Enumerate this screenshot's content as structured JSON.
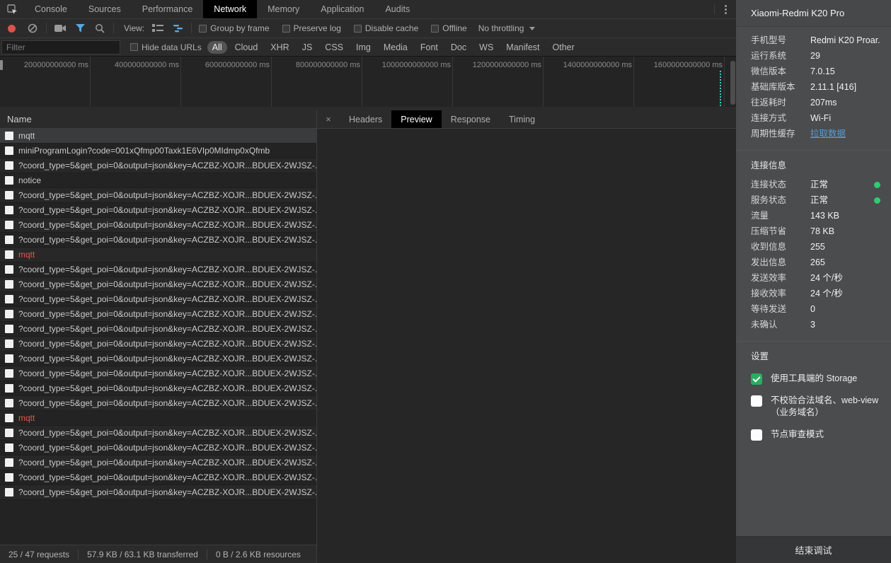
{
  "main_tabs": {
    "items": [
      {
        "label": "Console",
        "state": ""
      },
      {
        "label": "Sources",
        "state": ""
      },
      {
        "label": "Performance",
        "state": ""
      },
      {
        "label": "Network",
        "state": "active"
      },
      {
        "label": "Memory",
        "state": ""
      },
      {
        "label": "Application",
        "state": ""
      },
      {
        "label": "Audits",
        "state": ""
      }
    ]
  },
  "toolbar": {
    "view_label": "View:",
    "checkboxes": [
      {
        "label": "Group by frame",
        "state": "unchecked"
      },
      {
        "label": "Preserve log",
        "state": "unchecked"
      },
      {
        "label": "Disable cache",
        "state": "unchecked"
      },
      {
        "label": "Offline",
        "state": "unchecked"
      }
    ],
    "throttling_value": "No throttling"
  },
  "filter_bar": {
    "filter_placeholder": "Filter",
    "hide_data_urls_label": "Hide data URLs",
    "chips": [
      {
        "label": "All",
        "state": "active"
      },
      {
        "label": "Cloud",
        "state": ""
      },
      {
        "label": "XHR",
        "state": ""
      },
      {
        "label": "JS",
        "state": ""
      },
      {
        "label": "CSS",
        "state": ""
      },
      {
        "label": "Img",
        "state": ""
      },
      {
        "label": "Media",
        "state": ""
      },
      {
        "label": "Font",
        "state": ""
      },
      {
        "label": "Doc",
        "state": ""
      },
      {
        "label": "WS",
        "state": ""
      },
      {
        "label": "Manifest",
        "state": ""
      },
      {
        "label": "Other",
        "state": ""
      }
    ]
  },
  "overview": {
    "ticks": [
      "200000000000 ms",
      "400000000000 ms",
      "600000000000 ms",
      "800000000000 ms",
      "1000000000000 ms",
      "1200000000000 ms",
      "1400000000000 ms",
      "1600000000000 ms"
    ]
  },
  "request_table": {
    "name_header": "Name",
    "rows": [
      {
        "label": "mqtt",
        "state": "selected"
      },
      {
        "label": "miniProgramLogin?code=001xQfmp00Taxk1E6VIp0MIdmp0xQfmb",
        "state": ""
      },
      {
        "label": "?coord_type=5&get_poi=0&output=json&key=ACZBZ-XOJR...BDUEX-2WJSZ-...",
        "state": ""
      },
      {
        "label": "notice",
        "state": ""
      },
      {
        "label": "?coord_type=5&get_poi=0&output=json&key=ACZBZ-XOJR...BDUEX-2WJSZ-...",
        "state": ""
      },
      {
        "label": "?coord_type=5&get_poi=0&output=json&key=ACZBZ-XOJR...BDUEX-2WJSZ-...",
        "state": ""
      },
      {
        "label": "?coord_type=5&get_poi=0&output=json&key=ACZBZ-XOJR...BDUEX-2WJSZ-...",
        "state": ""
      },
      {
        "label": "?coord_type=5&get_poi=0&output=json&key=ACZBZ-XOJR...BDUEX-2WJSZ-...",
        "state": ""
      },
      {
        "label": "mqtt",
        "state": "error"
      },
      {
        "label": "?coord_type=5&get_poi=0&output=json&key=ACZBZ-XOJR...BDUEX-2WJSZ-...",
        "state": ""
      },
      {
        "label": "?coord_type=5&get_poi=0&output=json&key=ACZBZ-XOJR...BDUEX-2WJSZ-...",
        "state": ""
      },
      {
        "label": "?coord_type=5&get_poi=0&output=json&key=ACZBZ-XOJR...BDUEX-2WJSZ-...",
        "state": ""
      },
      {
        "label": "?coord_type=5&get_poi=0&output=json&key=ACZBZ-XOJR...BDUEX-2WJSZ-...",
        "state": ""
      },
      {
        "label": "?coord_type=5&get_poi=0&output=json&key=ACZBZ-XOJR...BDUEX-2WJSZ-...",
        "state": ""
      },
      {
        "label": "?coord_type=5&get_poi=0&output=json&key=ACZBZ-XOJR...BDUEX-2WJSZ-...",
        "state": ""
      },
      {
        "label": "?coord_type=5&get_poi=0&output=json&key=ACZBZ-XOJR...BDUEX-2WJSZ-...",
        "state": ""
      },
      {
        "label": "?coord_type=5&get_poi=0&output=json&key=ACZBZ-XOJR...BDUEX-2WJSZ-...",
        "state": ""
      },
      {
        "label": "?coord_type=5&get_poi=0&output=json&key=ACZBZ-XOJR...BDUEX-2WJSZ-...",
        "state": ""
      },
      {
        "label": "?coord_type=5&get_poi=0&output=json&key=ACZBZ-XOJR...BDUEX-2WJSZ-...",
        "state": ""
      },
      {
        "label": "mqtt",
        "state": "error"
      },
      {
        "label": "?coord_type=5&get_poi=0&output=json&key=ACZBZ-XOJR...BDUEX-2WJSZ-...",
        "state": ""
      },
      {
        "label": "?coord_type=5&get_poi=0&output=json&key=ACZBZ-XOJR...BDUEX-2WJSZ-...",
        "state": ""
      },
      {
        "label": "?coord_type=5&get_poi=0&output=json&key=ACZBZ-XOJR...BDUEX-2WJSZ-...",
        "state": ""
      },
      {
        "label": "?coord_type=5&get_poi=0&output=json&key=ACZBZ-XOJR...BDUEX-2WJSZ-...",
        "state": ""
      },
      {
        "label": "?coord_type=5&get_poi=0&output=json&key=ACZBZ-XOJR...BDUEX-2WJSZ-...",
        "state": ""
      }
    ]
  },
  "detail_tabs": {
    "close_glyph": "×",
    "items": [
      {
        "label": "Headers",
        "state": ""
      },
      {
        "label": "Preview",
        "state": "active"
      },
      {
        "label": "Response",
        "state": ""
      },
      {
        "label": "Timing",
        "state": ""
      }
    ]
  },
  "status_bar": {
    "segments": [
      {
        "text": "25 / 47 requests"
      },
      {
        "text": "57.9 KB / 63.1 KB transferred"
      },
      {
        "text": "0 B / 2.6 KB resources"
      }
    ]
  },
  "sidebar": {
    "title": "Xiaomi-Redmi K20 Pro",
    "device_info": [
      {
        "label": "手机型号",
        "value": "Redmi K20 Proar...",
        "value_type": ""
      },
      {
        "label": "运行系统",
        "value": "29",
        "value_type": ""
      },
      {
        "label": "微信版本",
        "value": "7.0.15",
        "value_type": ""
      },
      {
        "label": "基础库版本",
        "value": "2.11.1 [416]",
        "value_type": ""
      },
      {
        "label": "往返耗时",
        "value": "207ms",
        "value_type": ""
      },
      {
        "label": "连接方式",
        "value": "Wi-Fi",
        "value_type": ""
      },
      {
        "label": "周期性缓存",
        "value": "拉取数据",
        "value_type": "link"
      }
    ],
    "connection_section": {
      "title": "连接信息",
      "rows": [
        {
          "label": "连接状态",
          "value": "正常",
          "dot": "green"
        },
        {
          "label": "服务状态",
          "value": "正常",
          "dot": "green"
        },
        {
          "label": "流量",
          "value": "143 KB",
          "dot": ""
        },
        {
          "label": "压缩节省",
          "value": "78 KB",
          "dot": ""
        },
        {
          "label": "收到信息",
          "value": "255",
          "dot": ""
        },
        {
          "label": "发出信息",
          "value": "265",
          "dot": ""
        },
        {
          "label": "发送效率",
          "value": "24 个/秒",
          "dot": ""
        },
        {
          "label": "接收效率",
          "value": "24 个/秒",
          "dot": ""
        },
        {
          "label": "等待发送",
          "value": "0",
          "dot": ""
        },
        {
          "label": "未确认",
          "value": "3",
          "dot": ""
        }
      ]
    },
    "settings_section": {
      "title": "设置",
      "items": [
        {
          "label": "使用工具端的 Storage",
          "state": "checked"
        },
        {
          "label": "不校验合法域名、web-view（业务域名）",
          "state": "unchecked"
        },
        {
          "label": "节点审查模式",
          "state": "unchecked"
        }
      ]
    },
    "footer_button": "结束调试"
  },
  "colors": {
    "accent_blue": "#57a8e2",
    "error_red": "#e0554d",
    "status_green": "#2ecc71",
    "link_blue": "#5b9bd5",
    "checkbox_green": "#27ae60",
    "record_red": "#d9534c"
  }
}
